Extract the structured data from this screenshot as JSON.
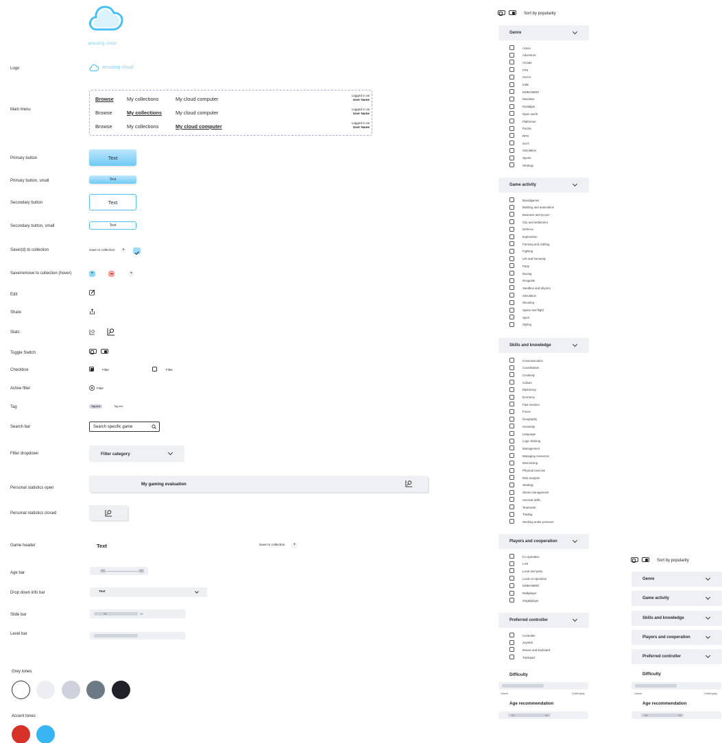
{
  "brand": {
    "name": "amusing cloud",
    "logo_icon": "cloud-icon"
  },
  "rows": {
    "logo": "Logo",
    "main_menu": "Main menu",
    "primary_button": "Primary button",
    "primary_button_small": "Primary button, small",
    "secondary_button": "Secondary button",
    "secondary_button_small": "Secondary button, small",
    "save_to_collection": "Save/(d) to collection",
    "save_remove_hover": "Save/remove to collection (hover)",
    "edit": "Edit",
    "share": "Share",
    "stats": "Stats",
    "toggle_switch": "Toggle Switch",
    "checkbox": "Checkbox",
    "active_filter": "Active filter",
    "tag": "Tag",
    "search_bar": "Search bar",
    "filter_dropdown": "Filter dropdown",
    "personal_stats_open": "Personal statistics open",
    "personal_stats_closed": "Personal statistics closed",
    "game_header": "Game header",
    "age_bar": "Age bar",
    "drop_down_info_bar": "Drop down info bar",
    "slide_bar": "Slide bar",
    "level_bar": "Level bar"
  },
  "menu": {
    "items": [
      "Browse",
      "My collections",
      "My cloud computer"
    ],
    "logged_in_label": "Logged in as",
    "user_name": "User Name"
  },
  "buttons": {
    "text": "Text"
  },
  "save": {
    "label": "Save to collection",
    "plus": "+"
  },
  "checkbox": {
    "filter_label": "Filter"
  },
  "active_filter": {
    "label": "Filter"
  },
  "tags": [
    "Tag text",
    "Tag text"
  ],
  "search": {
    "placeholder": "Search specific game"
  },
  "filter_dropdown": {
    "label": "Filter category"
  },
  "personal_stats": {
    "title": "My gaming evaluation"
  },
  "game_header": {
    "title": "Text",
    "save_label": "Save to collection",
    "plus": "+"
  },
  "age_bar": {
    "min": "XX",
    "max": "XX"
  },
  "info_bar": {
    "label": "Text"
  },
  "slide_bar": {
    "min": "XX",
    "max": "XX",
    "level": 0.5
  },
  "level_bar": {
    "level": 0.5
  },
  "palette": {
    "grey_label": "Grey tones",
    "grey": [
      "#ffffff",
      "#eceef2",
      "#cfd2dd",
      "#6c7a85",
      "#202028"
    ],
    "accent_label": "Accent tones",
    "accent": [
      "#d6322a",
      "#36b5f2"
    ]
  },
  "sidebar": {
    "sort_label": "Sort by popularity",
    "sections": [
      {
        "title": "Genre",
        "items": [
          "Action",
          "Adventure",
          "Arcade",
          "FPS",
          "Horror",
          "Indie",
          "MOBA/MMO",
          "Narrative",
          "Nostalgia",
          "Open world",
          "Platformer",
          "Puzzle",
          "RPG",
          "Sci-fi",
          "Simulation",
          "Sports",
          "Strategy"
        ]
      },
      {
        "title": "Game activity",
        "items": [
          "Boardgames",
          "Building and automation",
          "Business and tycoon",
          "City and settlement",
          "Defence",
          "Exploration",
          "Farming and crafting",
          "Fighting",
          "Life and humanity",
          "Party",
          "Racing",
          "Rougelite",
          "Sandbox and physics",
          "Simulation",
          "Shooting",
          "Space and flight",
          "Sport",
          "Styling"
        ]
      },
      {
        "title": "Skills and knowledge",
        "items": [
          "Communication",
          "Coordination",
          "Creativity",
          "Culture",
          "Diplomacy",
          "Economy",
          "Fast reaction",
          "Focus",
          "Geography",
          "Humanity",
          "Language",
          "Logic thinking",
          "Management",
          "Managing resources",
          "Memorising",
          "Physical exercise",
          "Risk analysis",
          "Strategy",
          "Stress management",
          "Survival skills",
          "Teamwork",
          "Trading",
          "Working under pressure"
        ]
      },
      {
        "title": "Players and cooperation",
        "items": [
          "Co-operative",
          "LAN",
          "Local and party",
          "Local co-operative",
          "MOBA/MMO",
          "Multiplayer",
          "Singleplayer"
        ]
      },
      {
        "title": "Preferred controller",
        "items": [
          "Controller",
          "Joystick",
          "Mouse and keyboard",
          "Trackpad"
        ]
      }
    ],
    "difficulty": {
      "title": "Difficulty",
      "min_label": "Casual",
      "max_label": "Challenging",
      "level": 0.5
    },
    "age": {
      "title": "Age recommendation",
      "min": "XX",
      "max": "XX"
    }
  },
  "collapsed": {
    "sort_label": "Sort by popularity",
    "sections": [
      "Genre",
      "Game activity",
      "Skills and knowledge",
      "Players and cooperation",
      "Preferred controller"
    ],
    "difficulty": {
      "title": "Difficulty",
      "min_label": "Casual",
      "max_label": "Challenging",
      "level": 0.5
    },
    "age": {
      "title": "Age recommendation",
      "min": "XX",
      "max": "XX"
    }
  }
}
